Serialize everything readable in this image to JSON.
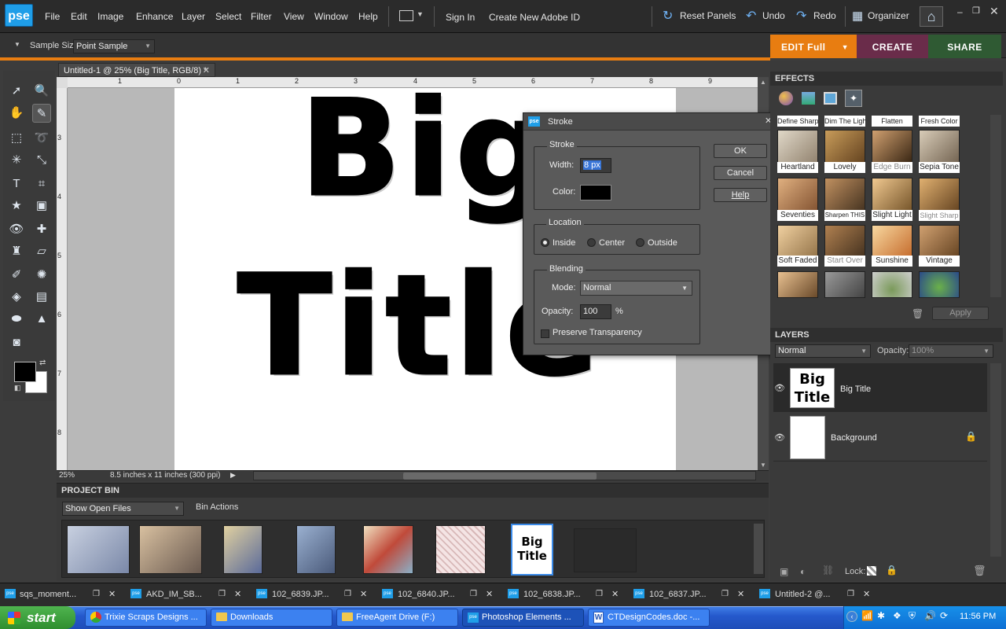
{
  "app": {
    "logo_text": "pse"
  },
  "menu": {
    "items": [
      "File",
      "Edit",
      "Image",
      "Enhance",
      "Layer",
      "Select",
      "Filter",
      "View",
      "Window",
      "Help"
    ],
    "sign_in": "Sign In",
    "create_id": "Create New Adobe ID",
    "reset_panels": "Reset Panels",
    "undo": "Undo",
    "redo": "Redo",
    "organizer": "Organizer"
  },
  "options_bar": {
    "sample_size_label": "Sample Size:",
    "sample_size_value": "Point Sample"
  },
  "mode_tabs": {
    "edit": "EDIT Full",
    "create": "CREATE",
    "share": "SHARE"
  },
  "document": {
    "tab_title": "Untitled-1 @ 25% (Big  Title, RGB/8) *",
    "text_line1": "Big",
    "text_line2": "Title",
    "zoom": "25%",
    "doc_info": "8.5 inches x 11 inches (300 ppi)",
    "ruler_h": [
      "1",
      "0",
      "1",
      "2",
      "3",
      "4",
      "5",
      "6",
      "7",
      "8",
      "9"
    ],
    "ruler_v": [
      "3",
      "4",
      "5",
      "6",
      "7",
      "8"
    ]
  },
  "stroke_dialog": {
    "title": "Stroke",
    "stroke_group": "Stroke",
    "width_label": "Width:",
    "width_value": "8 px",
    "color_label": "Color:",
    "color_value": "#000000",
    "location_group": "Location",
    "loc_inside": "Inside",
    "loc_center": "Center",
    "loc_outside": "Outside",
    "selected_location": "Inside",
    "blending_group": "Blending",
    "mode_label": "Mode:",
    "mode_value": "Normal",
    "opacity_label": "Opacity:",
    "opacity_value": "100",
    "opacity_unit": "%",
    "preserve_label": "Preserve Transparency",
    "ok": "OK",
    "cancel": "Cancel",
    "help": "Help"
  },
  "effects_panel": {
    "title": "EFFECTS",
    "top_row": [
      "Define Sharp",
      "Dim The Lights",
      "Flatten",
      "Fresh Color"
    ],
    "thumbs": [
      "Heartland",
      "Lovely",
      "Edge Burn",
      "Sepia Tone",
      "Seventies",
      "Sharpen THIS",
      "Slight Light",
      "Slight Sharp",
      "Soft Faded",
      "Start Over",
      "Sunshine",
      "Vintage"
    ],
    "apply": "Apply"
  },
  "layers_panel": {
    "title": "LAYERS",
    "blend_mode": "Normal",
    "opacity_label": "Opacity:",
    "opacity_value": "100%",
    "layers": [
      {
        "name": "Big  Title",
        "thumb": "Big Title"
      },
      {
        "name": "Background"
      }
    ],
    "lock_label": "Lock:"
  },
  "project_bin": {
    "title": "PROJECT BIN",
    "show": "Show Open Files",
    "actions": "Bin Actions",
    "selected_thumb_text": "Big Title"
  },
  "window_tabs": [
    "sqs_moment...",
    "AKD_IM_SB...",
    "102_6839.JP...",
    "102_6840.JP...",
    "102_6838.JP...",
    "102_6837.JP...",
    "Untitled-2 @..."
  ],
  "taskbar": {
    "start": "start",
    "tasks": [
      "Trixie Scraps Designs ...",
      "Downloads",
      "FreeAgent Drive (F:)",
      "Photoshop Elements ...",
      "CTDesignCodes.doc -..."
    ],
    "clock": "11:56 PM"
  },
  "colors": {
    "accent_orange": "#e87d11",
    "create_tab": "#6a2c4a",
    "share_tab": "#2f5a33",
    "pse_blue": "#1f9ee8"
  }
}
